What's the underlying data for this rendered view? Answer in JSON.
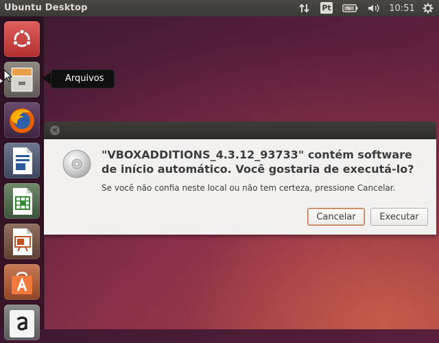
{
  "top_panel": {
    "title": "Ubuntu Desktop",
    "keyboard_indicator": "Pt",
    "clock": "10:51",
    "icons": [
      "network-arrows-icon",
      "keyboard-layout-icon",
      "battery-icon",
      "volume-icon",
      "gear-icon"
    ]
  },
  "launcher": {
    "items": [
      "dash-home",
      "files",
      "firefox",
      "libreoffice-writer",
      "libreoffice-calc",
      "libreoffice-impress",
      "ubuntu-software-center",
      "amazon"
    ]
  },
  "tooltip": {
    "label": "Arquivos"
  },
  "dialog": {
    "heading_line1": "\"VBOXADDITIONS_4.3.12_93733\" contém software",
    "heading_line2": "de início automático. Você gostaria de executá-lo?",
    "message": "Se você não confia neste local ou não tem certeza, pressione Cancelar.",
    "cancel_label": "Cancelar",
    "run_label": "Executar",
    "close_glyph": "×"
  },
  "colors": {
    "panel": "#3c3b37",
    "launcher": "#2a1020",
    "dialog_bg": "#f2f1f0",
    "ubuntu_orange": "#dd4814"
  }
}
